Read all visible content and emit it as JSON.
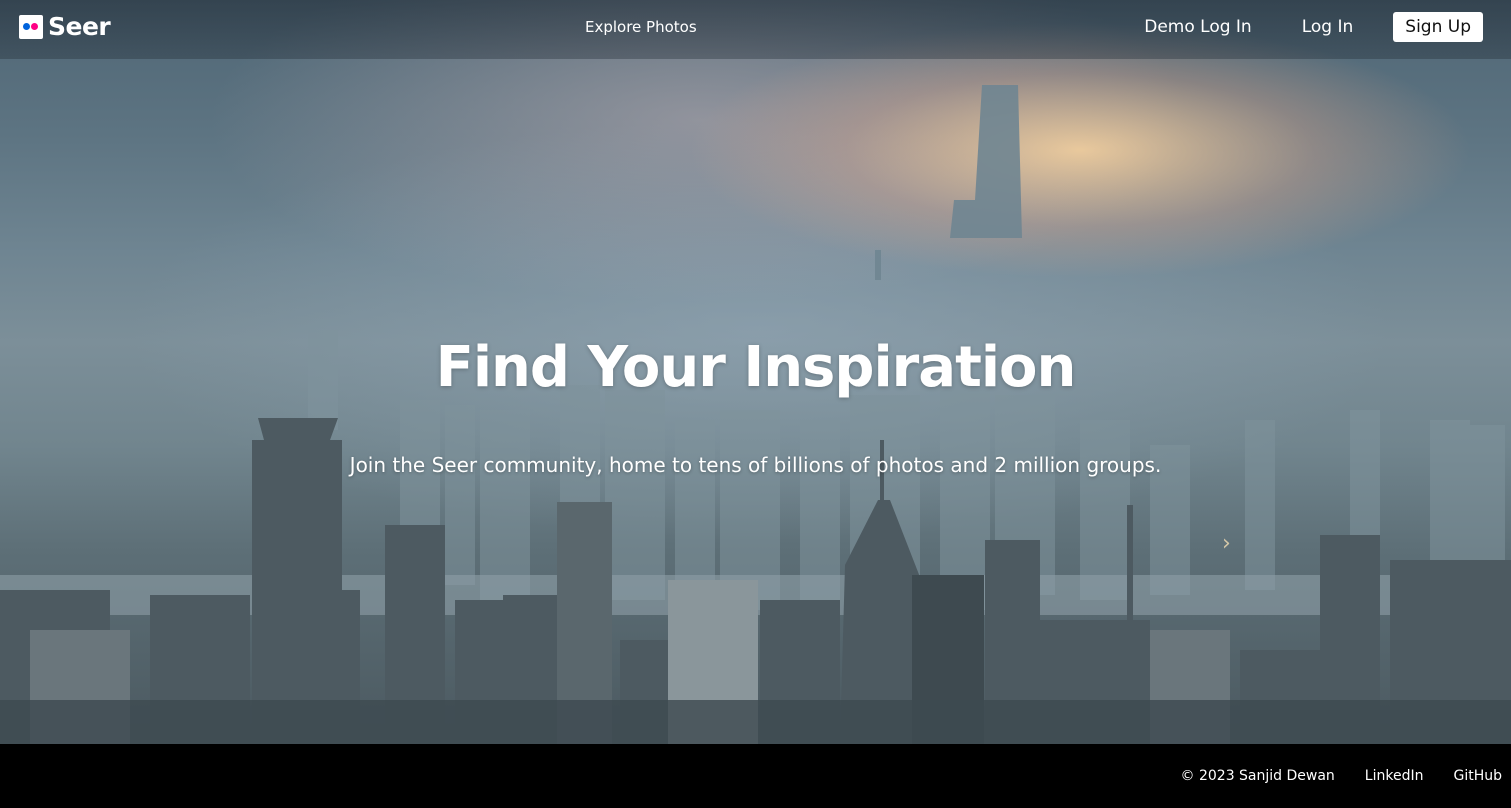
{
  "brand": {
    "name": "Seer",
    "logo_icon": "seer-logo-icon",
    "colors": {
      "blue": "#0063dc",
      "pink": "#ff0084"
    }
  },
  "header": {
    "explore_label": "Explore Photos",
    "demo_login_label": "Demo Log In",
    "login_label": "Log In",
    "signup_label": "Sign Up"
  },
  "hero": {
    "title": "Find Your Inspiration",
    "subtitle": "Join the Seer community, home to tens of billions of photos and 2 million groups.",
    "next_icon": "chevron-right-icon"
  },
  "footer": {
    "copyright": "© 2023 Sanjid Dewan",
    "linkedin_label": "LinkedIn",
    "github_label": "GitHub"
  }
}
